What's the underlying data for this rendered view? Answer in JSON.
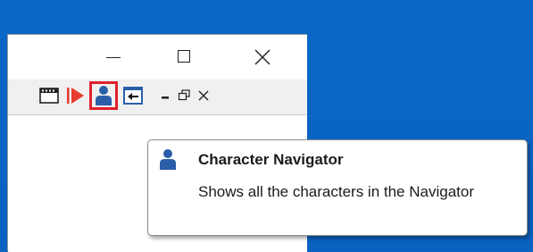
{
  "colors": {
    "desktop": "#0a66c2",
    "highlight_border": "#e0212b",
    "person_icon": "#2a5ea8",
    "play_icon": "#e53a2f"
  },
  "icons": {
    "film": "film-strip-icon",
    "play": "play-icon",
    "character": "person-icon",
    "back": "back-arrow-icon",
    "dock_minimize": "minimize-icon",
    "dock_restore": "restore-icon",
    "dock_close": "close-icon"
  },
  "tooltip": {
    "title": "Character Navigator",
    "description": "Shows all the characters in the Navigator"
  }
}
